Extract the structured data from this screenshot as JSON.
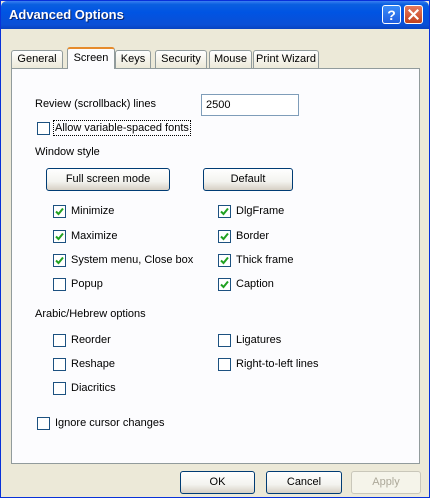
{
  "window": {
    "title": "Advanced Options",
    "help_glyph": "?"
  },
  "tabs": [
    {
      "label": "General",
      "active": false
    },
    {
      "label": "Screen",
      "active": true
    },
    {
      "label": "Keys",
      "active": false
    },
    {
      "label": "Security",
      "active": false
    },
    {
      "label": "Mouse",
      "active": false
    },
    {
      "label": "Print Wizard",
      "active": false
    }
  ],
  "screen": {
    "review_label": "Review (scrollback) lines",
    "review_value": "2500",
    "allow_variable_fonts": {
      "label": "Allow variable-spaced fonts",
      "checked": false
    },
    "window_style_label": "Window style",
    "full_screen_button": "Full screen mode",
    "default_button": "Default",
    "window_style_checks": [
      {
        "label": "Minimize",
        "checked": true
      },
      {
        "label": "Maximize",
        "checked": true
      },
      {
        "label": "System menu, Close box",
        "checked": true
      },
      {
        "label": "Popup",
        "checked": false
      },
      {
        "label": "DlgFrame",
        "checked": true
      },
      {
        "label": "Border",
        "checked": true
      },
      {
        "label": "Thick frame",
        "checked": true
      },
      {
        "label": "Caption",
        "checked": true
      }
    ],
    "arabic_label": "Arabic/Hebrew options",
    "arabic_checks": [
      {
        "label": "Reorder",
        "checked": false
      },
      {
        "label": "Reshape",
        "checked": false
      },
      {
        "label": "Diacritics",
        "checked": false
      },
      {
        "label": "Ligatures",
        "checked": false
      },
      {
        "label": "Right-to-left lines",
        "checked": false
      }
    ],
    "ignore_cursor": {
      "label": "Ignore cursor changes",
      "checked": false
    }
  },
  "footer": {
    "ok": "OK",
    "cancel": "Cancel",
    "apply": "Apply"
  }
}
